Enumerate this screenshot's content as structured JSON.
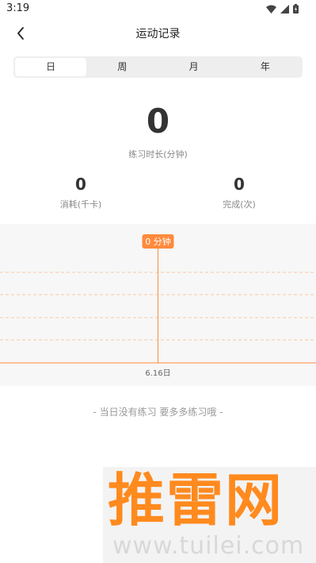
{
  "status_bar": {
    "time": "3:19"
  },
  "header": {
    "title": "运动记录"
  },
  "tabs": [
    {
      "label": "日",
      "active": true
    },
    {
      "label": "周",
      "active": false
    },
    {
      "label": "月",
      "active": false
    },
    {
      "label": "年",
      "active": false
    }
  ],
  "summary": {
    "duration_value": "0",
    "duration_label": "练习时长(分钟)",
    "calories_value": "0",
    "calories_label": "消耗(千卡)",
    "completed_value": "0",
    "completed_label": "完成(次)"
  },
  "chart_data": {
    "type": "bar",
    "categories": [
      "6.16日"
    ],
    "values": [
      0
    ],
    "title": "",
    "xlabel": "",
    "ylabel": "",
    "tooltip": "0 分钟",
    "grid": true
  },
  "empty_message": "- 当日没有练习 要多多练习哦 -",
  "watermark": {
    "text": "推雷网",
    "url": "www.tuilei.com"
  },
  "colors": {
    "accent": "#ff8a3d",
    "grid": "#f5b98a"
  }
}
